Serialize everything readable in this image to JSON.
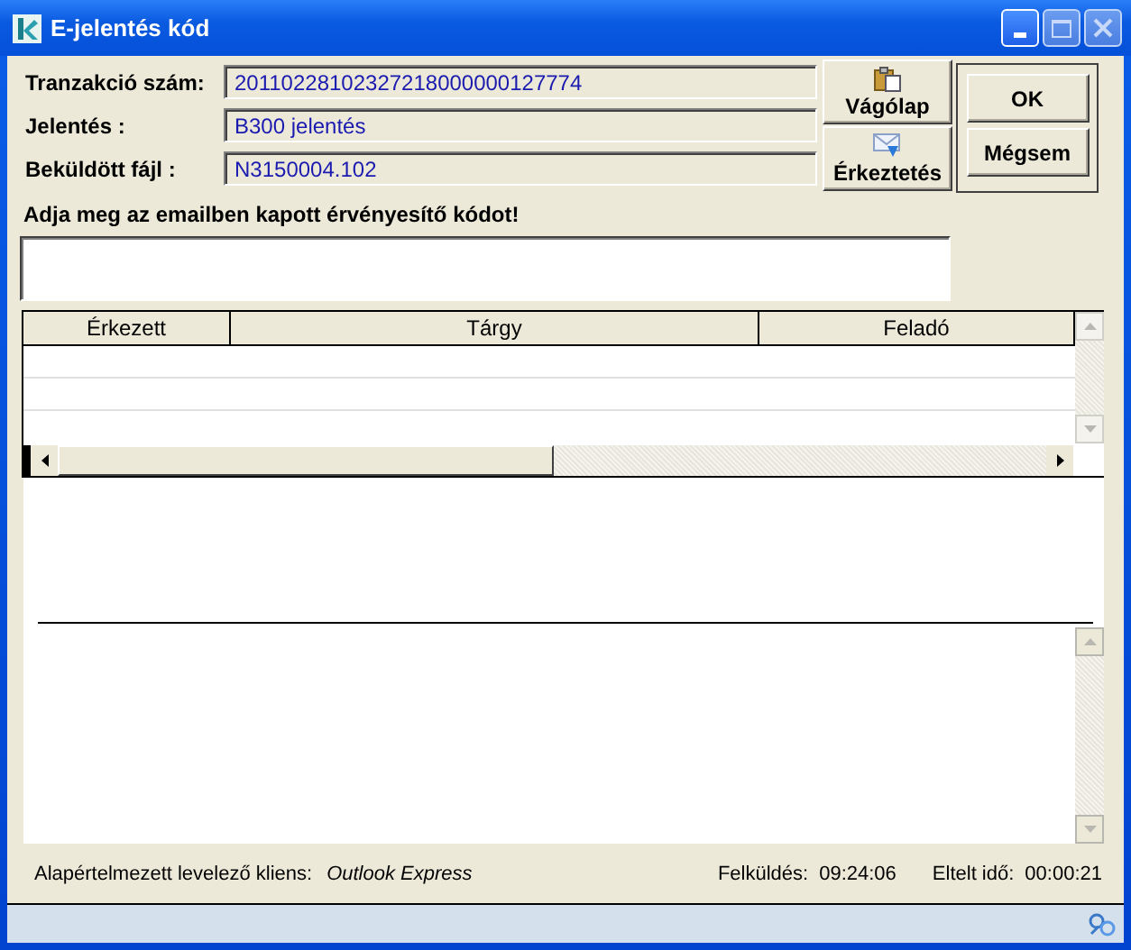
{
  "window": {
    "title": "E-jelentés kód"
  },
  "fields": [
    {
      "label": "Tranzakció szám:",
      "value": "20110228102327218000000127774"
    },
    {
      "label": "Jelentés :",
      "value": "B300 jelentés"
    },
    {
      "label": "Beküldött fájl :",
      "value": "N3150004.102"
    }
  ],
  "side_buttons": [
    {
      "label": "Vágólap",
      "kind": "clipboard"
    },
    {
      "label": "Érkeztetés",
      "kind": "mail"
    }
  ],
  "buttons": [
    "OK",
    "Mégsem"
  ],
  "code_prompt": "Adja meg az emailben kapott érvényesítő kódot!",
  "table": {
    "columns": [
      "Érkezett",
      "Tárgy",
      "Feladó"
    ]
  },
  "status": {
    "client_label": "Alapértelmezett levelező kliens:",
    "client": "Outlook Express",
    "sent_label": "Felküldés:",
    "sent": "09:24:06",
    "elapsed_label": "Eltelt idő:",
    "elapsed": "00:00:21"
  }
}
